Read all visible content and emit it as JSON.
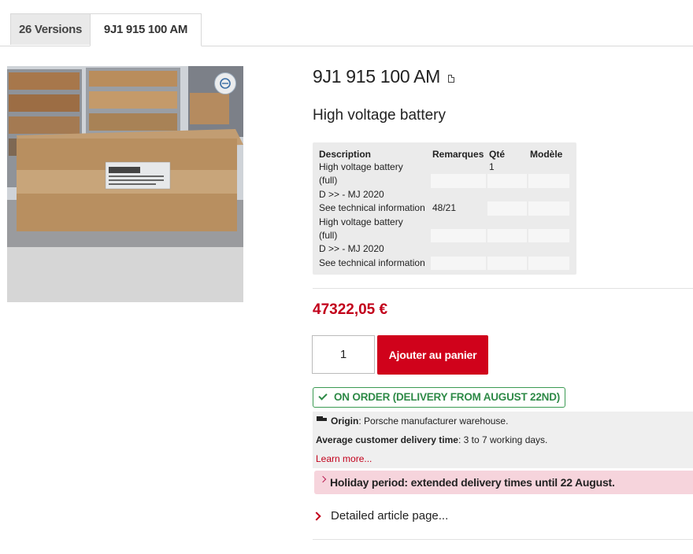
{
  "tabs": [
    {
      "label": "26 Versions"
    },
    {
      "label": "9J1 915 100 AM"
    }
  ],
  "product": {
    "reference": "9J1 915 100 AM",
    "name": "High voltage battery",
    "image_alt": "Cardboard box containing the high voltage battery"
  },
  "spec_table": {
    "headers": [
      "Description",
      "Remarques",
      "Qté",
      "Modèle"
    ],
    "rows": [
      [
        "High voltage battery",
        "",
        "1",
        ""
      ],
      [
        "(full)",
        "",
        "",
        ""
      ],
      [
        "D >> - MJ 2020",
        "",
        "",
        ""
      ],
      [
        "See technical information",
        "48/21",
        "",
        ""
      ],
      [
        "High voltage battery",
        "",
        "",
        ""
      ],
      [
        "(full)",
        "",
        "",
        ""
      ],
      [
        "D >> - MJ 2020",
        "",
        "",
        ""
      ],
      [
        "See technical information",
        "",
        "",
        ""
      ]
    ]
  },
  "price": "47322,05 €",
  "cart": {
    "quantity": "1",
    "button_label": "Ajouter au panier"
  },
  "availability": {
    "status": "ON ORDER (DELIVERY FROM AUGUST 22ND)",
    "origin_label": "Origin",
    "origin_value": ": Porsche manufacturer warehouse.",
    "delivery_label": "Average customer delivery time",
    "delivery_value": ": 3 to 7 working days.",
    "learn_more": "Learn more..."
  },
  "notice": {
    "holiday": "Holiday period: extended delivery times until 22 August."
  },
  "links": {
    "detailed_page": "Detailed article page..."
  },
  "colors": {
    "accent": "#d0021b",
    "price": "#c2001b",
    "status_green": "#2e8a47",
    "holiday_bg": "#f6d4dc"
  },
  "icons": [
    "zoom-icon",
    "document-icon",
    "check-icon",
    "truck-icon",
    "chevron-right-icon"
  ]
}
